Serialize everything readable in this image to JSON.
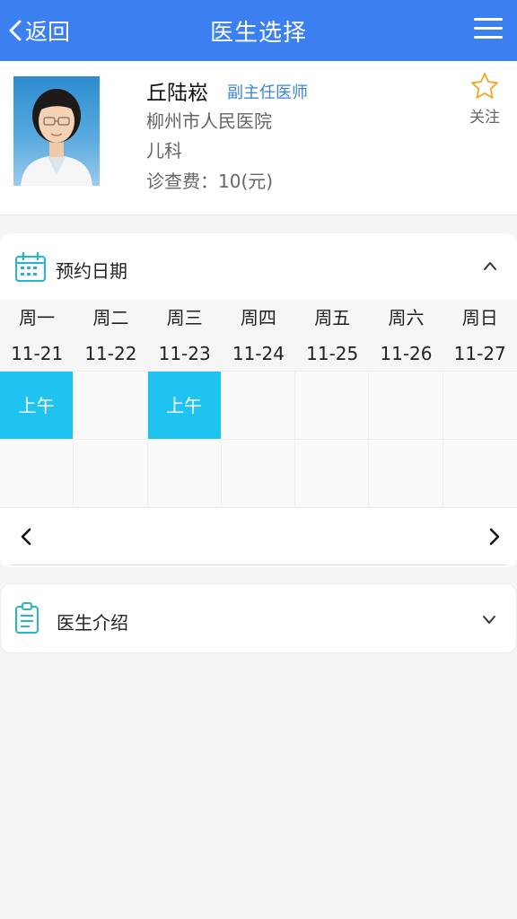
{
  "header": {
    "back_label": "返回",
    "title": "医生选择"
  },
  "doctor": {
    "name": "丘陆崧",
    "title": "副主任医师",
    "hospital": "柳州市人民医院",
    "department": "儿科",
    "fee": "诊查费：10(元)",
    "follow_label": "关注"
  },
  "booking": {
    "section_title": "预约日期",
    "days": [
      {
        "weekday": "周一",
        "date": "11-21",
        "slot": "上午"
      },
      {
        "weekday": "周二",
        "date": "11-22",
        "slot": ""
      },
      {
        "weekday": "周三",
        "date": "11-23",
        "slot": "上午"
      },
      {
        "weekday": "周四",
        "date": "11-24",
        "slot": ""
      },
      {
        "weekday": "周五",
        "date": "11-25",
        "slot": ""
      },
      {
        "weekday": "周六",
        "date": "11-26",
        "slot": ""
      },
      {
        "weekday": "周日",
        "date": "11-27",
        "slot": ""
      }
    ]
  },
  "intro": {
    "section_title": "医生介绍"
  },
  "colors": {
    "header_bg": "#3b7ff0",
    "slot_active": "#1ec3ef",
    "title_badge": "#3b84d8",
    "star_outline": "#f5a623"
  }
}
